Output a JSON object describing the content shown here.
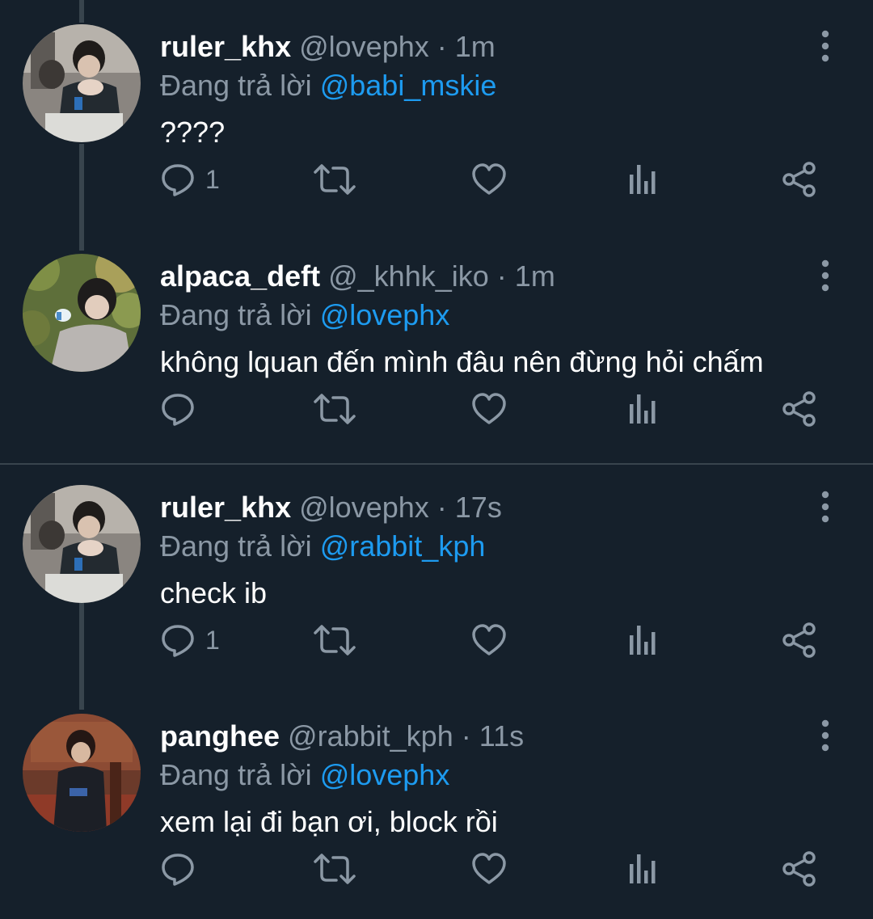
{
  "reply_prefix": "Đang trả lời",
  "tweets": [
    {
      "name": "ruler_khx",
      "handle": "@lovephx",
      "separator": "·",
      "time": "1m",
      "reply_to": "@babi_mskie",
      "text": "????",
      "reply_count": "1",
      "avatar": "avatar-ruler-khx"
    },
    {
      "name": "alpaca_deft",
      "handle": "@_khhk_iko",
      "separator": "·",
      "time": "1m",
      "reply_to": "@lovephx",
      "text": "không lquan đến mình đâu nên đừng hỏi chấm",
      "reply_count": "",
      "avatar": "avatar-alpaca-deft"
    },
    {
      "name": "ruler_khx",
      "handle": "@lovephx",
      "separator": "·",
      "time": "17s",
      "reply_to": "@rabbit_kph",
      "text": "check ib",
      "reply_count": "1",
      "avatar": "avatar-ruler-khx"
    },
    {
      "name": "panghee",
      "handle": "@rabbit_kph",
      "separator": "·",
      "time": "11s",
      "reply_to": "@lovephx",
      "text": "xem lại đi bạn ơi, block rồi",
      "reply_count": "",
      "avatar": "avatar-panghee"
    }
  ],
  "icons": {
    "reply": "reply-icon",
    "retweet": "retweet-icon",
    "like": "heart-icon",
    "views": "views-icon",
    "share": "share-icon",
    "more": "more-vertical-icon"
  },
  "colors": {
    "background": "#15202b",
    "text": "#ffffff",
    "muted": "#8b98a5",
    "accent": "#1d9bf0",
    "line": "#38444d"
  }
}
